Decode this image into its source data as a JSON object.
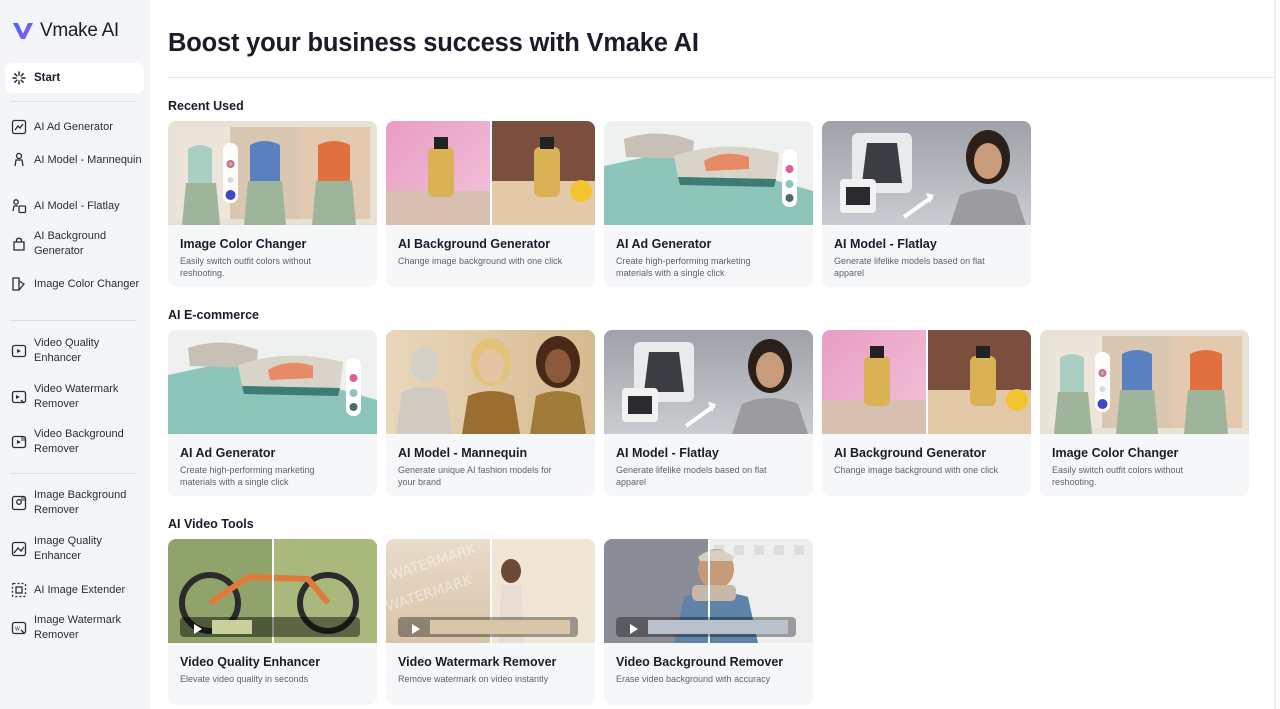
{
  "app": {
    "name": "Vmake AI"
  },
  "sidebar": {
    "start": "Start",
    "items": [
      {
        "label": "AI Ad Generator",
        "icon": "ad-generator-icon"
      },
      {
        "label": "AI Model - Mannequin",
        "icon": "mannequin-icon"
      },
      {
        "label": "AI Model - Flatlay",
        "icon": "flatlay-icon"
      },
      {
        "label": "AI Background Generator",
        "icon": "background-generator-icon"
      },
      {
        "label": "Image Color Changer",
        "icon": "color-changer-icon"
      },
      {
        "label": "Video Quality Enhancer",
        "icon": "video-enhancer-icon"
      },
      {
        "label": "Video Watermark Remover",
        "icon": "video-watermark-icon"
      },
      {
        "label": "Video Background Remover",
        "icon": "video-background-icon"
      },
      {
        "label": "Image Background Remover",
        "icon": "image-background-icon"
      },
      {
        "label": "Image Quality Enhancer",
        "icon": "image-enhancer-icon"
      },
      {
        "label": "AI Image Extender",
        "icon": "image-extender-icon"
      },
      {
        "label": "Image Watermark Remover",
        "icon": "image-watermark-icon"
      }
    ]
  },
  "main": {
    "title": "Boost your business success with Vmake AI",
    "sections": [
      {
        "title": "Recent Used",
        "cards": [
          {
            "title": "Image Color Changer",
            "desc": "Easily switch outfit colors without reshooting."
          },
          {
            "title": "AI Background Generator",
            "desc": "Change image background with one click"
          },
          {
            "title": "AI Ad Generator",
            "desc": "Create high-performing marketing materials with a single click"
          },
          {
            "title": "AI Model - Flatlay",
            "desc": "Generate lifelike models based on flat apparel"
          }
        ]
      },
      {
        "title": "AI E-commerce",
        "cards": [
          {
            "title": "AI Ad Generator",
            "desc": "Create high-performing marketing materials with a single click"
          },
          {
            "title": "AI Model - Mannequin",
            "desc": "Generate unique AI fashion models for your brand"
          },
          {
            "title": "AI Model - Flatlay",
            "desc": "Generate lifelike models based on flat apparel"
          },
          {
            "title": "AI Background Generator",
            "desc": "Change image background with one click"
          },
          {
            "title": "Image Color Changer",
            "desc": "Easily switch outfit colors without reshooting."
          }
        ]
      },
      {
        "title": "AI Video Tools",
        "cards": [
          {
            "title": "Video Quality Enhancer",
            "desc": "Elevate video quality in seconds"
          },
          {
            "title": "Video Watermark Remover",
            "desc": "Remove watermark on video instantly"
          },
          {
            "title": "Video Background Remover",
            "desc": "Erase video background with accuracy"
          }
        ]
      }
    ]
  },
  "colors": {
    "sidebar_bg": "#f3f5f8",
    "card_bg": "#f6f7f9",
    "logo_gradient": [
      "#3b6cff",
      "#9b4dff"
    ]
  }
}
